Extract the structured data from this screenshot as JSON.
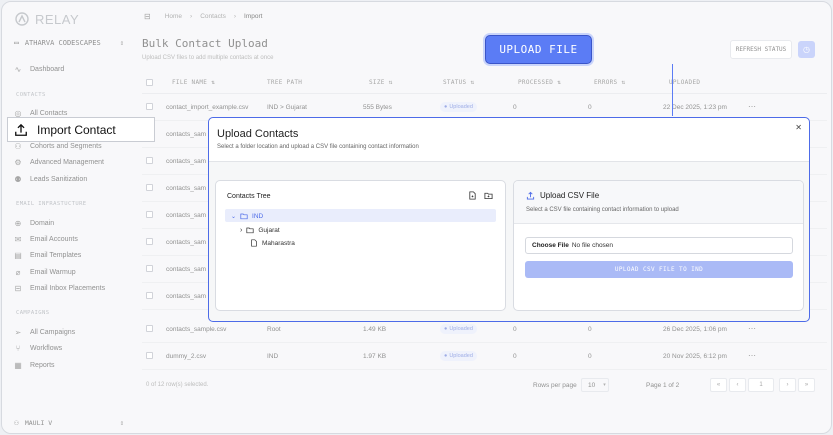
{
  "app": {
    "logo_text": "RELAY"
  },
  "workspace": {
    "name": "ATHARVA CODESCAPES"
  },
  "sidebar": {
    "items": [
      {
        "label": "Dashboard",
        "icon": "activity-icon"
      }
    ],
    "sections": [
      {
        "title": "CONTACTS",
        "items": [
          {
            "label": "All Contacts",
            "icon": "user-circle-icon"
          },
          {
            "label": "Import Contact",
            "icon": "upload-icon",
            "active": true
          },
          {
            "label": "Cohorts and Segments",
            "icon": "users-icon"
          },
          {
            "label": "Advanced Management",
            "icon": "settings-icon"
          },
          {
            "label": "Leads Sanitization",
            "icon": "user-check-icon"
          }
        ]
      },
      {
        "title": "EMAIL INFRASTUCTURE",
        "items": [
          {
            "label": "Domain",
            "icon": "globe-icon"
          },
          {
            "label": "Email Accounts",
            "icon": "mail-icon"
          },
          {
            "label": "Email Templates",
            "icon": "template-icon"
          },
          {
            "label": "Email Warmup",
            "icon": "thermometer-icon"
          },
          {
            "label": "Email Inbox Placements",
            "icon": "inbox-icon"
          }
        ]
      },
      {
        "title": "CAMPAIGNS",
        "items": [
          {
            "label": "All Campaigns",
            "icon": "send-icon"
          },
          {
            "label": "Workflows",
            "icon": "workflow-icon"
          },
          {
            "label": "Reports",
            "icon": "report-icon"
          }
        ]
      }
    ]
  },
  "user": {
    "name": "MAULI V"
  },
  "breadcrumb": [
    "Home",
    "Contacts",
    "Import"
  ],
  "page": {
    "title": "Bulk Contact Upload",
    "subtitle": "Upload CSV files to add multiple contacts at once",
    "upload_btn": "UPLOAD FILE",
    "refresh_btn": "REFRESH STATUS"
  },
  "table": {
    "columns": [
      "FILE NAME",
      "TREE PATH",
      "SIZE",
      "STATUS",
      "PROCESSED",
      "ERRORS",
      "UPLOADED"
    ],
    "rows": [
      {
        "file": "contact_import_example.csv",
        "path": "IND > Gujarat",
        "size": "555 Bytes",
        "status": "Uploaded",
        "processed": "0",
        "errors": "0",
        "uploaded": "22 Dec 2025, 1:23 pm"
      },
      {
        "file": "contacts_sam"
      },
      {
        "file": "contacts_sam"
      },
      {
        "file": "contacts_sam"
      },
      {
        "file": "contacts_sam"
      },
      {
        "file": "contacts_sam"
      },
      {
        "file": "contacts_sam"
      },
      {
        "file": "contacts_sam"
      },
      {
        "file": "contacts_sample.csv",
        "path": "Root",
        "size": "1.49 KB",
        "status": "Uploaded",
        "processed": "0",
        "errors": "0",
        "uploaded": "26 Dec 2025, 1:06 pm"
      },
      {
        "file": "dummy_2.csv",
        "path": "IND",
        "size": "1.97 KB",
        "status": "Uploaded",
        "processed": "0",
        "errors": "0",
        "uploaded": "20 Nov 2025, 6:12 pm"
      }
    ],
    "selection_text": "0 of 12 row(s) selected.",
    "rows_per_page_label": "Rows per page",
    "rows_per_page": "10",
    "page_label": "Page 1 of 2",
    "page_input": "1"
  },
  "modal": {
    "title": "Upload Contacts",
    "subtitle": "Select a folder location and upload a CSV file containing contact information",
    "tree": {
      "title": "Contacts Tree",
      "nodes": [
        {
          "label": "IND",
          "type": "folder",
          "selected": true
        },
        {
          "label": "Gujarat",
          "type": "folder"
        },
        {
          "label": "Maharastra",
          "type": "file"
        }
      ]
    },
    "csv": {
      "title": "Upload CSV File",
      "subtitle": "Select a CSV file containing contact information to upload",
      "choose_label": "Choose File",
      "no_file": "No file chosen",
      "upload_btn": "UPLOAD CSV FILE TO IND"
    }
  }
}
